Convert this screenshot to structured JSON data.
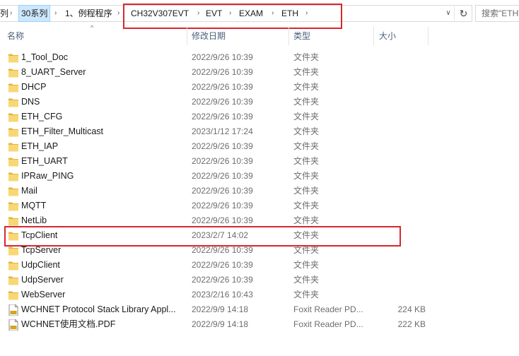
{
  "address_bar": {
    "crumbs": [
      "列",
      "30系列",
      "1、例程程序",
      "CH32V307EVT",
      "EVT",
      "EXAM",
      "ETH"
    ],
    "search_placeholder": "搜索\"ETH\""
  },
  "columns": {
    "name": "名称",
    "date": "修改日期",
    "type": "类型",
    "size": "大小"
  },
  "files": [
    {
      "name": "1_Tool_Doc",
      "date": "2022/9/26 10:39",
      "type": "文件夹",
      "size": "",
      "icon": "folder-icon"
    },
    {
      "name": "8_UART_Server",
      "date": "2022/9/26 10:39",
      "type": "文件夹",
      "size": "",
      "icon": "folder-icon"
    },
    {
      "name": "DHCP",
      "date": "2022/9/26 10:39",
      "type": "文件夹",
      "size": "",
      "icon": "folder-icon"
    },
    {
      "name": "DNS",
      "date": "2022/9/26 10:39",
      "type": "文件夹",
      "size": "",
      "icon": "folder-icon"
    },
    {
      "name": "ETH_CFG",
      "date": "2022/9/26 10:39",
      "type": "文件夹",
      "size": "",
      "icon": "folder-icon"
    },
    {
      "name": "ETH_Filter_Multicast",
      "date": "2023/1/12 17:24",
      "type": "文件夹",
      "size": "",
      "icon": "folder-icon"
    },
    {
      "name": "ETH_IAP",
      "date": "2022/9/26 10:39",
      "type": "文件夹",
      "size": "",
      "icon": "folder-icon"
    },
    {
      "name": "ETH_UART",
      "date": "2022/9/26 10:39",
      "type": "文件夹",
      "size": "",
      "icon": "folder-icon"
    },
    {
      "name": "IPRaw_PING",
      "date": "2022/9/26 10:39",
      "type": "文件夹",
      "size": "",
      "icon": "folder-icon"
    },
    {
      "name": "Mail",
      "date": "2022/9/26 10:39",
      "type": "文件夹",
      "size": "",
      "icon": "folder-icon"
    },
    {
      "name": "MQTT",
      "date": "2022/9/26 10:39",
      "type": "文件夹",
      "size": "",
      "icon": "folder-icon"
    },
    {
      "name": "NetLib",
      "date": "2022/9/26 10:39",
      "type": "文件夹",
      "size": "",
      "icon": "folder-icon"
    },
    {
      "name": "TcpClient",
      "date": "2023/2/7 14:02",
      "type": "文件夹",
      "size": "",
      "icon": "folder-icon"
    },
    {
      "name": "TcpServer",
      "date": "2022/9/26 10:39",
      "type": "文件夹",
      "size": "",
      "icon": "folder-icon"
    },
    {
      "name": "UdpClient",
      "date": "2022/9/26 10:39",
      "type": "文件夹",
      "size": "",
      "icon": "folder-icon"
    },
    {
      "name": "UdpServer",
      "date": "2022/9/26 10:39",
      "type": "文件夹",
      "size": "",
      "icon": "folder-icon"
    },
    {
      "name": "WebServer",
      "date": "2023/2/16 10:43",
      "type": "文件夹",
      "size": "",
      "icon": "folder-icon"
    },
    {
      "name": "WCHNET Protocol Stack Library Appl...",
      "date": "2022/9/9 14:18",
      "type": "Foxit Reader PD...",
      "size": "224 KB",
      "icon": "pdf-icon"
    },
    {
      "name": "WCHNET使用文档.PDF",
      "date": "2022/9/9 14:18",
      "type": "Foxit Reader PD...",
      "size": "222 KB",
      "icon": "pdf-icon"
    }
  ],
  "colors": {
    "highlight_box": "#d9262e",
    "folder": "#f8d775",
    "selected_crumb": "#cce8ff"
  }
}
